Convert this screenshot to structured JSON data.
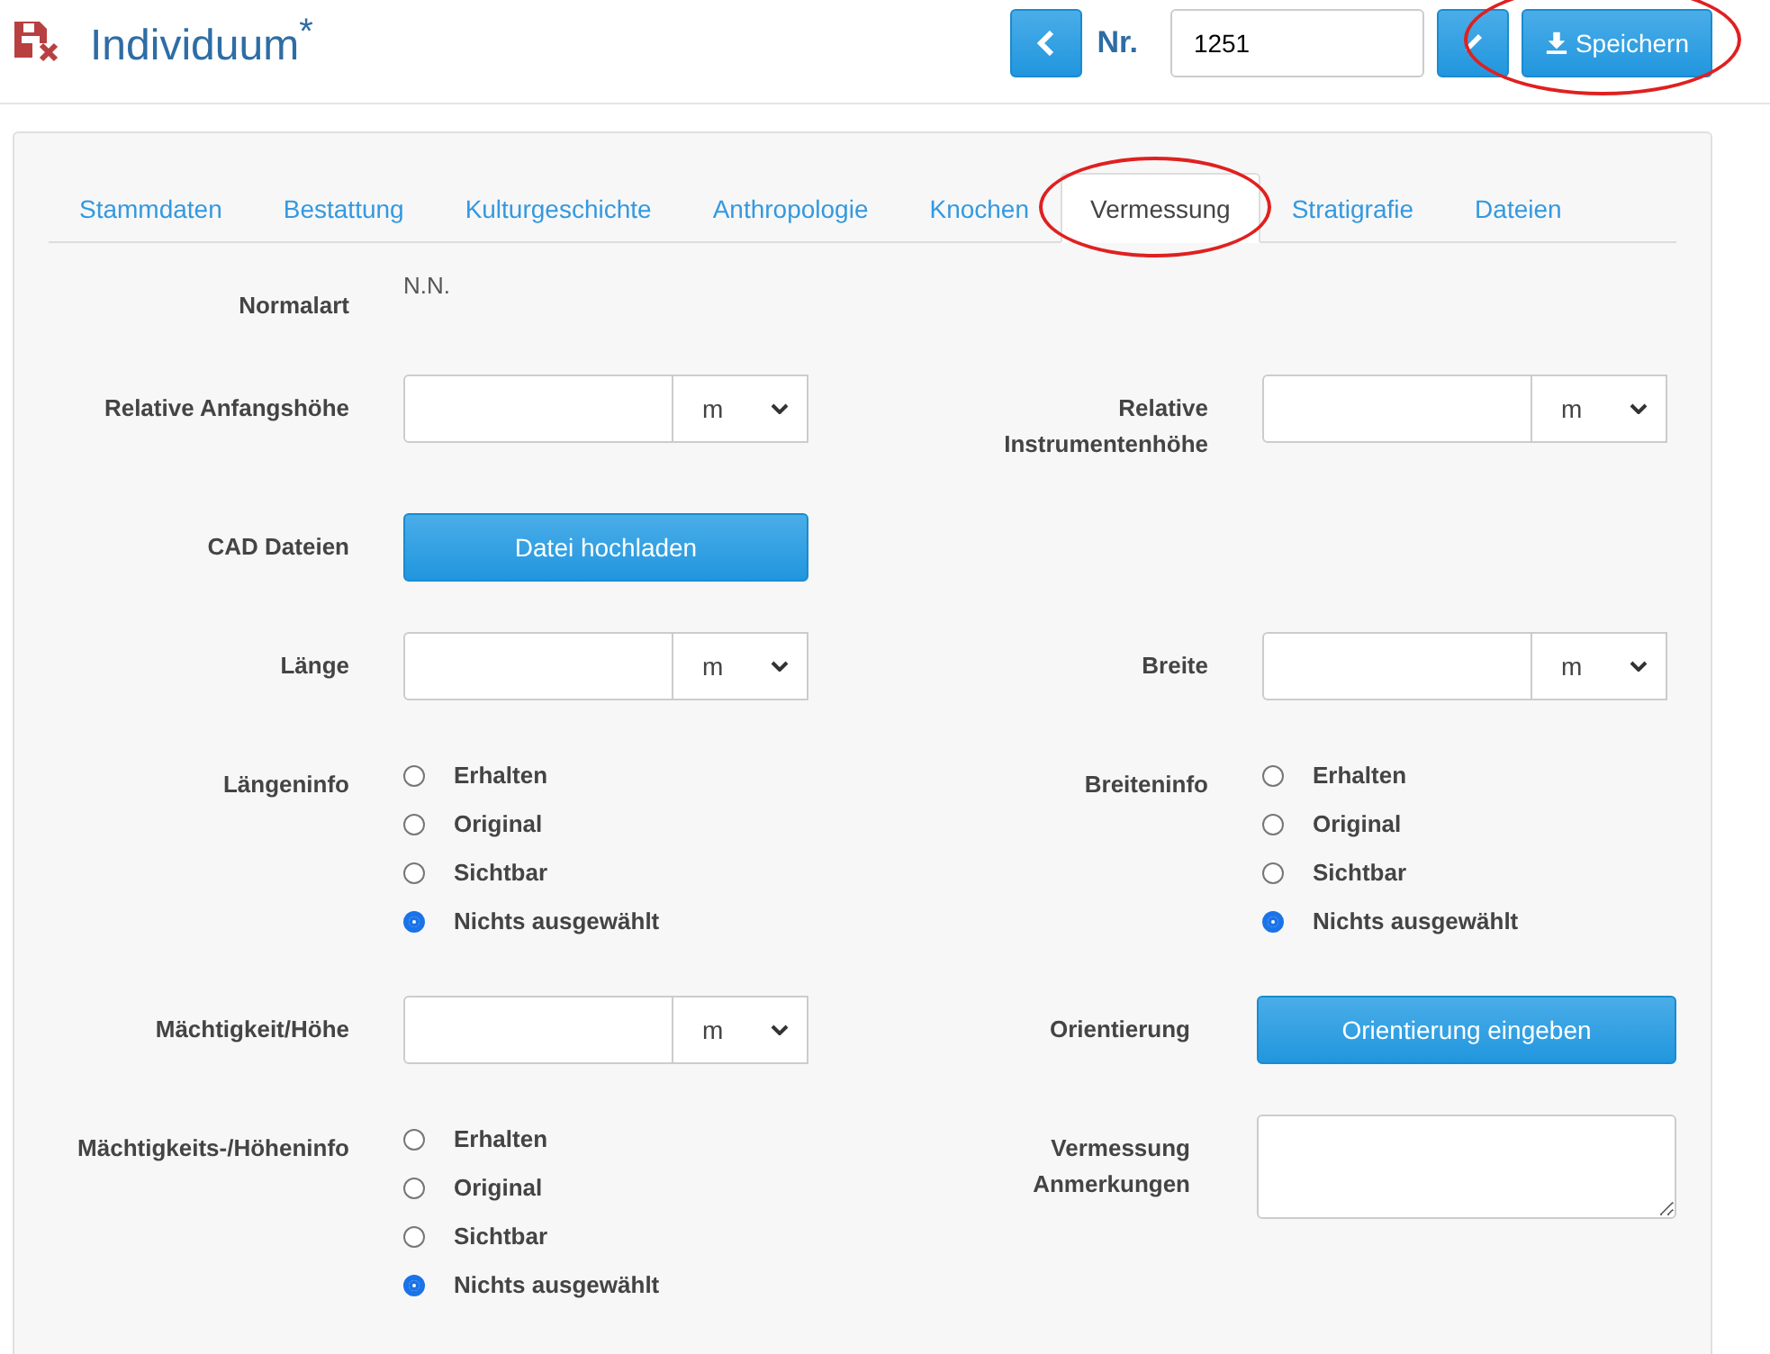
{
  "header": {
    "title": "Individuum$^{*}$",
    "nr_label": "Nr.",
    "nr_value": "1251",
    "save_button": {
      "label": "Speichern",
      "highlighted": true
    }
  },
  "tabs": [
    {
      "label": "Stammdaten",
      "selected": false,
      "highlighted": false
    },
    {
      "label": "Bestattung",
      "selected": false,
      "highlighted": false
    },
    {
      "label": "Kulturgeschichte",
      "selected": false,
      "highlighted": false
    },
    {
      "label": "Anthropologie",
      "selected": false,
      "highlighted": false
    },
    {
      "label": "Knochen",
      "selected": false,
      "highlighted": false
    },
    {
      "label": "Vermessung",
      "selected": true,
      "highlighted": true
    },
    {
      "label": "Stratigrafie",
      "selected": false,
      "highlighted": false
    },
    {
      "label": "Dateien",
      "selected": false,
      "highlighted": false
    }
  ],
  "rows": [
    {
      "left": {
        "kind": "text",
        "label": "Normalart",
        "value": "N.N."
      }
    },
    {
      "left": {
        "kind": "measure",
        "label": "Relative Anfangshöhe",
        "unit": "m"
      },
      "right": {
        "kind": "measure",
        "label": "Relative Instrumentenhöhe",
        "unit": "m"
      }
    },
    {
      "left": {
        "kind": "button",
        "label": "CAD Dateien",
        "button": "Datei hochladen"
      }
    },
    {
      "left": {
        "kind": "measure",
        "label": "Länge",
        "unit": "m"
      },
      "right": {
        "kind": "measure",
        "label": "Breite",
        "unit": "m"
      }
    },
    {
      "left": {
        "kind": "radio",
        "label": "Längeninfo",
        "options": [
          {
            "label": "Erhalten",
            "selected": false
          },
          {
            "label": "Original",
            "selected": false
          },
          {
            "label": "Sichtbar",
            "selected": false
          },
          {
            "label": "Nichts ausgewählt",
            "selected": true
          }
        ]
      },
      "right": {
        "kind": "radio",
        "label": "Breiteninfo",
        "options": [
          {
            "label": "Erhalten",
            "selected": false
          },
          {
            "label": "Original",
            "selected": false
          },
          {
            "label": "Sichtbar",
            "selected": false
          },
          {
            "label": "Nichts ausgewählt",
            "selected": true
          }
        ]
      }
    },
    {
      "left": {
        "kind": "measure",
        "label": "Mächtigkeit/Höhe",
        "unit": "m"
      },
      "right": {
        "kind": "button",
        "label": "Orientierung",
        "button": "Orientierung eingeben"
      }
    },
    {
      "left": {
        "kind": "radio",
        "label": "Mächtigkeits-/Höheninfo",
        "options": [
          {
            "label": "Erhalten",
            "selected": false
          },
          {
            "label": "Original",
            "selected": false
          },
          {
            "label": "Sichtbar",
            "selected": false
          },
          {
            "label": "Nichts ausgewählt",
            "selected": true
          }
        ]
      },
      "right": {
        "kind": "textarea",
        "label": "Vermessung Anmerkungen"
      }
    }
  ]
}
